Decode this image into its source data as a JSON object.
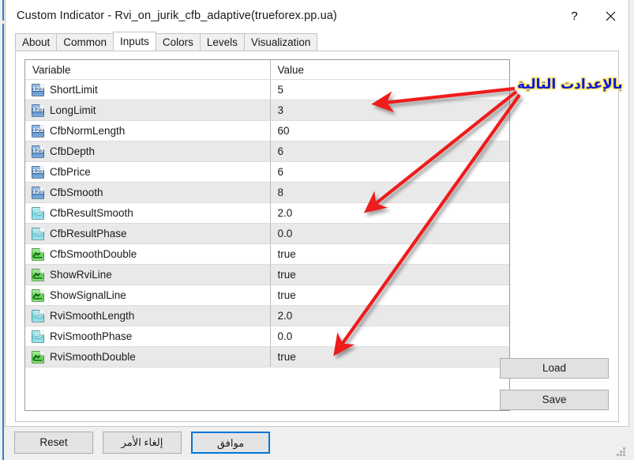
{
  "window": {
    "title": "Custom Indicator - Rvi_on_jurik_cfb_adaptive(trueforex.pp.ua)",
    "help_label": "?",
    "close_label": "✕"
  },
  "tabs": [
    {
      "label": "About",
      "active": false
    },
    {
      "label": "Common",
      "active": false
    },
    {
      "label": "Inputs",
      "active": true
    },
    {
      "label": "Colors",
      "active": false
    },
    {
      "label": "Levels",
      "active": false
    },
    {
      "label": "Visualization",
      "active": false
    }
  ],
  "table": {
    "headers": {
      "variable": "Variable",
      "value": "Value"
    },
    "rows": [
      {
        "icon": "int",
        "variable": "ShortLimit",
        "value": "5"
      },
      {
        "icon": "int",
        "variable": "LongLimit",
        "value": "3"
      },
      {
        "icon": "int",
        "variable": "CfbNormLength",
        "value": "60"
      },
      {
        "icon": "int",
        "variable": "CfbDepth",
        "value": "6"
      },
      {
        "icon": "int",
        "variable": "CfbPrice",
        "value": "6"
      },
      {
        "icon": "int",
        "variable": "CfbSmooth",
        "value": "8"
      },
      {
        "icon": "dbl",
        "variable": "CfbResultSmooth",
        "value": "2.0"
      },
      {
        "icon": "dbl",
        "variable": "CfbResultPhase",
        "value": "0.0"
      },
      {
        "icon": "bool",
        "variable": "CfbSmoothDouble",
        "value": "true"
      },
      {
        "icon": "bool",
        "variable": "ShowRviLine",
        "value": "true"
      },
      {
        "icon": "bool",
        "variable": "ShowSignalLine",
        "value": "true"
      },
      {
        "icon": "dbl",
        "variable": "RviSmoothLength",
        "value": "2.0"
      },
      {
        "icon": "dbl",
        "variable": "RviSmoothPhase",
        "value": "0.0"
      },
      {
        "icon": "bool",
        "variable": "RviSmoothDouble",
        "value": "true"
      }
    ]
  },
  "side_buttons": {
    "load_label": "Load",
    "save_label": "Save"
  },
  "bottom_buttons": {
    "reset_label": "Reset",
    "cancel_label": "إلغاء الأمر",
    "ok_label": "موافق"
  },
  "annotation": {
    "text": "بالإعدادت التالية",
    "color": "#0b17d8",
    "outline_color": "#ffe96b",
    "arrow_color": "#ee1c1c"
  },
  "colors": {
    "accent": "#0078d7",
    "window_edge": "#2a7fd4",
    "row_alt": "#e9e9e9",
    "button_face": "#e1e1e1"
  }
}
